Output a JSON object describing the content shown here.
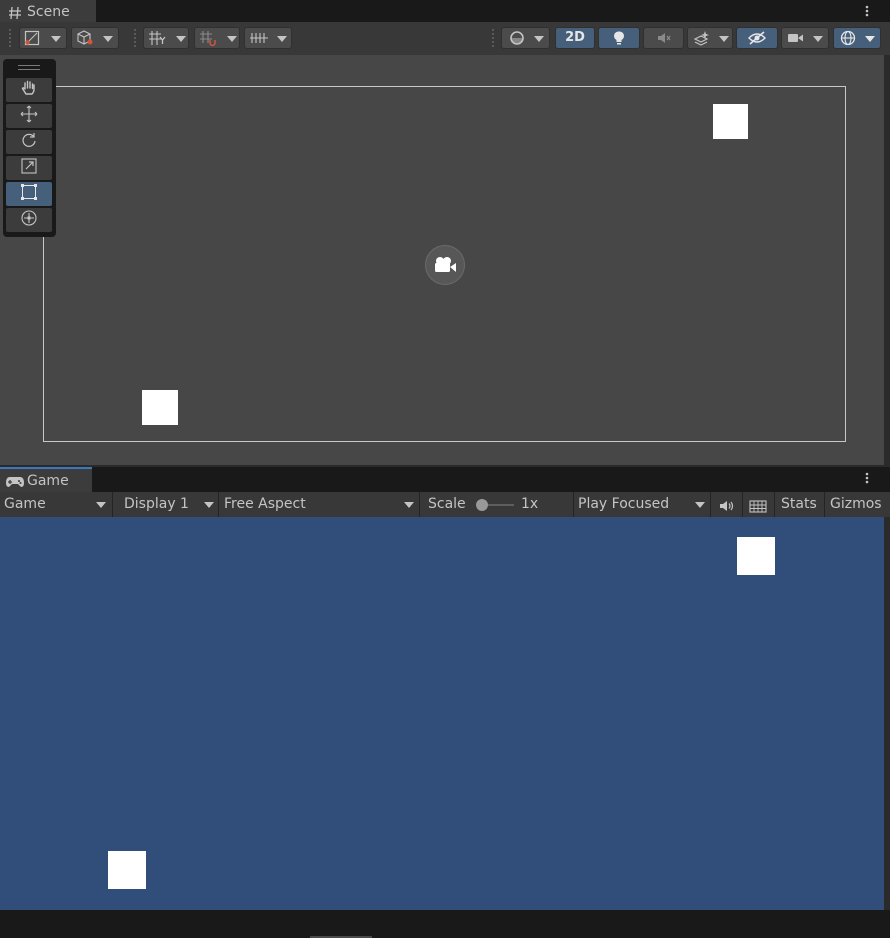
{
  "scene_panel": {
    "tab_label": "Scene",
    "tab_icon": "hash-icon"
  },
  "scene_toolbar": {
    "two_d_label": "2D"
  },
  "game_panel": {
    "tab_label": "Game",
    "tab_icon": "gamepad-icon"
  },
  "game_toolbar": {
    "view_mode": "Game",
    "display": "Display 1",
    "aspect": "Free Aspect",
    "scale_label": "Scale",
    "scale_value": "1x",
    "play_mode": "Play Focused",
    "stats_label": "Stats",
    "gizmos_label": "Gizmos"
  },
  "colors": {
    "scene_background": "#474747",
    "game_background": "#314d79",
    "active_button": "#46607c",
    "sprite": "#ffffff"
  }
}
